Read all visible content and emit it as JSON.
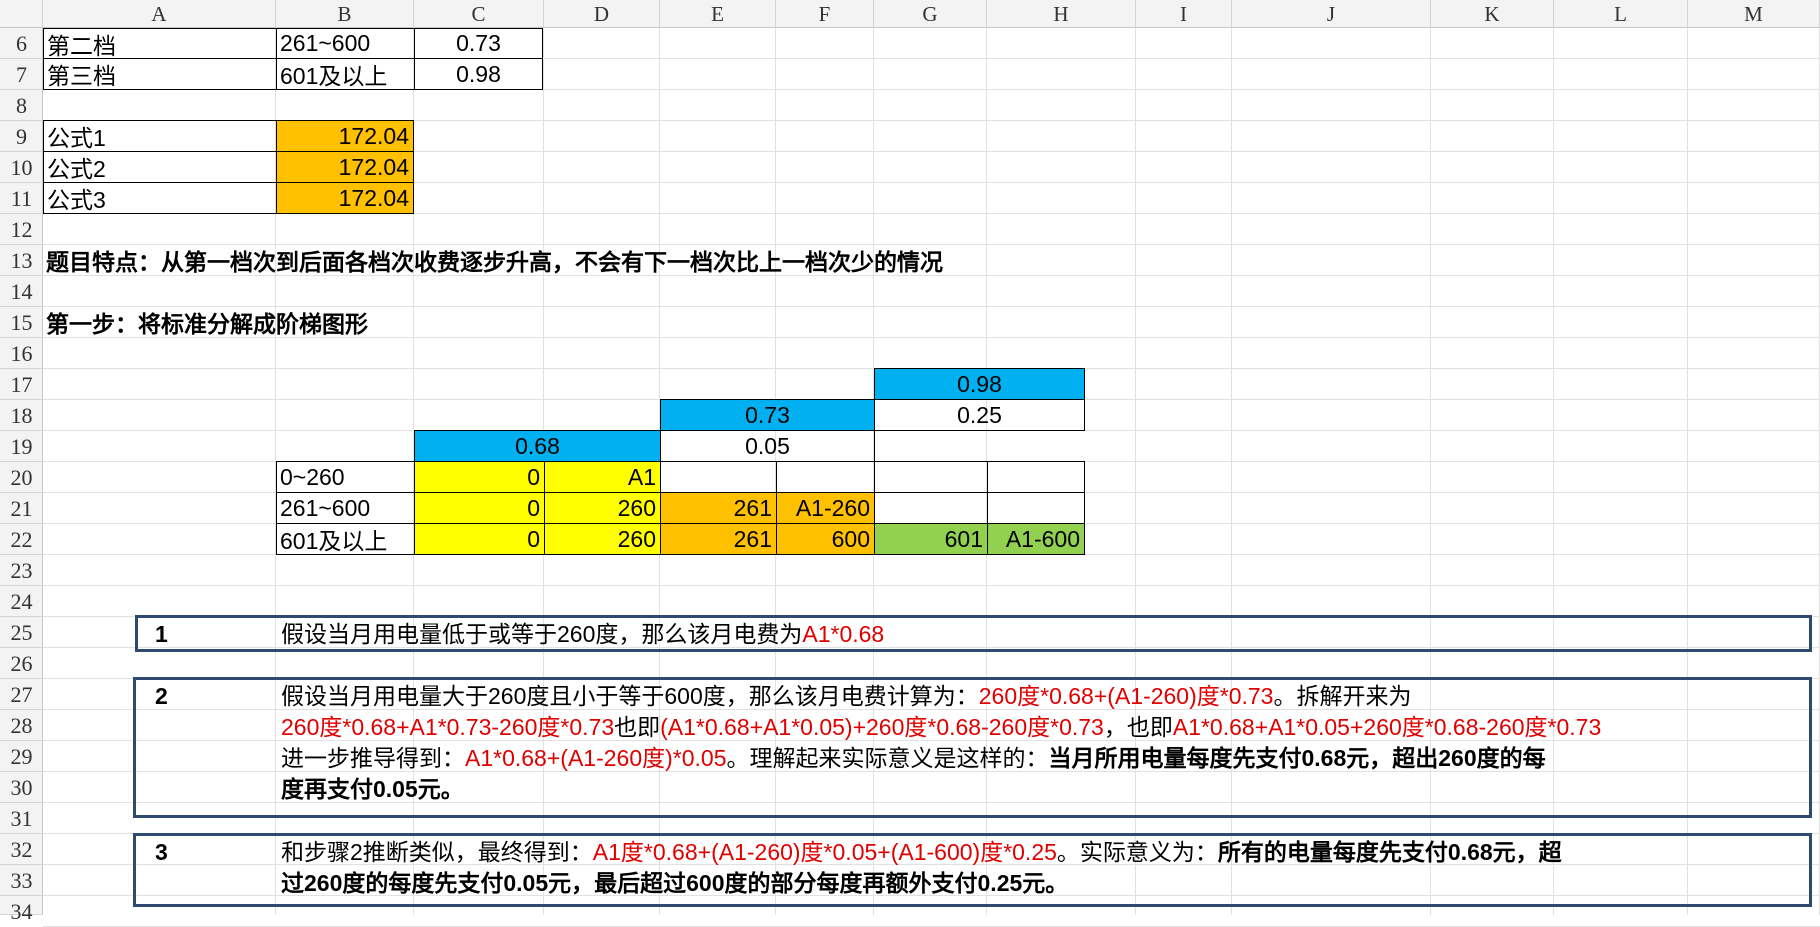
{
  "columns": [
    "A",
    "B",
    "C",
    "D",
    "E",
    "F",
    "G",
    "H",
    "I",
    "J",
    "K",
    "L",
    "M"
  ],
  "rows": [
    "6",
    "7",
    "8",
    "9",
    "10",
    "11",
    "12",
    "13",
    "14",
    "15",
    "16",
    "17",
    "18",
    "19",
    "20",
    "21",
    "22",
    "23",
    "24",
    "25",
    "26",
    "27",
    "28",
    "29",
    "30",
    "31",
    "32",
    "33",
    "34"
  ],
  "tiers": [
    {
      "name": "第二档",
      "range": "261~600",
      "rate": "0.73"
    },
    {
      "name": "第三档",
      "range": "601及以上",
      "rate": "0.98"
    }
  ],
  "formulas": [
    {
      "name": "公式1",
      "value": "172.04"
    },
    {
      "name": "公式2",
      "value": "172.04"
    },
    {
      "name": "公式3",
      "value": "172.04"
    }
  ],
  "row13_text": "题目特点：从第一档次到后面各档次收费逐步升高，不会有下一档次比上一档次少的情况",
  "row15_text": "第一步：将标准分解成阶梯图形",
  "stair": {
    "r17_rate": "0.98",
    "r18_rate": "0.73",
    "r18_diff": "0.25",
    "r19_rate": "0.68",
    "r19_diff": "0.05",
    "r20": [
      "0~260",
      "0",
      "A1",
      "",
      "",
      "",
      ""
    ],
    "r21": [
      "261~600",
      "0",
      "260",
      "261",
      "A1-260",
      "",
      ""
    ],
    "r22": [
      "601及以上",
      "0",
      "260",
      "261",
      "600",
      "601",
      "A1-600"
    ]
  },
  "notes": [
    {
      "num": "1",
      "lines": [
        [
          {
            "t": "假设当月用电量低于或等于260度，那么该月电费为",
            "s": "k"
          },
          {
            "t": "A1*0.68",
            "s": "red"
          }
        ]
      ]
    },
    {
      "num": "2",
      "lines": [
        [
          {
            "t": "假设当月用电量大于260度且小于等于600度，那么该月电费计算为：",
            "s": "k"
          },
          {
            "t": "260度*0.68+(A1-260)度*0.73",
            "s": "red"
          },
          {
            "t": "。拆解开来为",
            "s": "k"
          }
        ],
        [
          {
            "t": "260度*0.68+A1*0.73-260度*0.73",
            "s": "red"
          },
          {
            "t": "也即",
            "s": "k"
          },
          {
            "t": "(A1*0.68+A1*0.05)+260度*0.68-260度*0.73",
            "s": "red"
          },
          {
            "t": "，也即",
            "s": "k"
          },
          {
            "t": "A1*0.68+A1*0.05+260度*0.68-260度*0.73",
            "s": "red"
          }
        ],
        [
          {
            "t": "进一步推导得到：",
            "s": "k"
          },
          {
            "t": "A1*0.68+(A1-260度)*0.05",
            "s": "red"
          },
          {
            "t": "。理解起来实际意义是这样的：",
            "s": "k"
          },
          {
            "t": "当月所用电量每度先支付0.68元，超出260度的每",
            "s": "bold"
          }
        ],
        [
          {
            "t": "度再支付0.05元。",
            "s": "bold"
          }
        ]
      ]
    },
    {
      "num": "3",
      "lines": [
        [
          {
            "t": "和步骤2推断类似，最终得到：",
            "s": "k"
          },
          {
            "t": "A1度*0.68+(A1-260)度*0.05+(A1-600)度*0.25",
            "s": "red"
          },
          {
            "t": "。实际意义为：",
            "s": "k"
          },
          {
            "t": "所有的电量每度先支付0.68元，超",
            "s": "bold"
          }
        ],
        [
          {
            "t": "过260度的每度先支付0.05元，最后超过600度的部分每度再额外支付0.25元。",
            "s": "bold"
          }
        ]
      ]
    }
  ],
  "colors": {
    "orange": "#ffc000",
    "yellow": "#ffff00",
    "blue": "#00b0f0",
    "green": "#92d050",
    "red": "#e00000",
    "box_border": "#2e4a6e"
  }
}
